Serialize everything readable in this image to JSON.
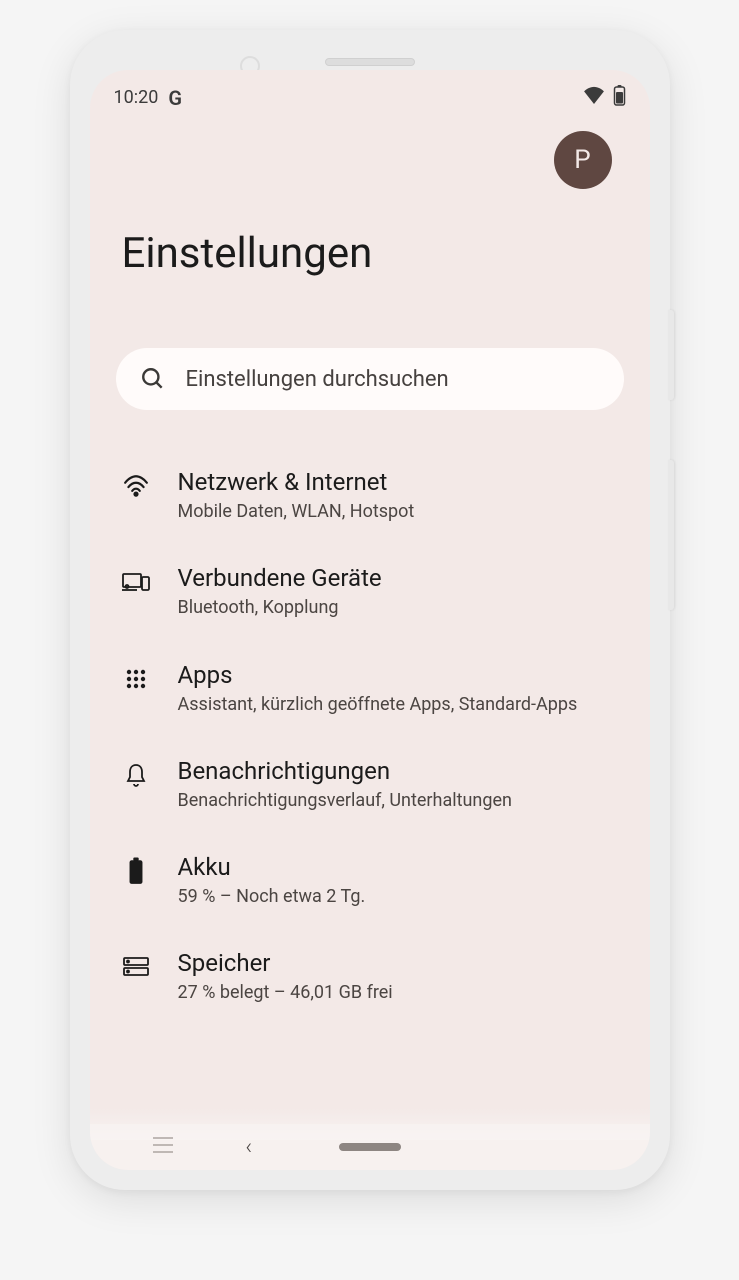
{
  "status": {
    "time": "10:20",
    "g": "G"
  },
  "header": {
    "avatar_initial": "P",
    "title": "Einstellungen"
  },
  "search": {
    "placeholder": "Einstellungen durchsuchen"
  },
  "items": [
    {
      "title": "Netzwerk & Internet",
      "subtitle": "Mobile Daten, WLAN, Hotspot"
    },
    {
      "title": "Verbundene Geräte",
      "subtitle": "Bluetooth, Kopplung"
    },
    {
      "title": "Apps",
      "subtitle": "Assistant, kürzlich geöffnete Apps, Standard‑Apps"
    },
    {
      "title": "Benachrichtigungen",
      "subtitle": "Benachrichtigungsverlauf, Unterhaltungen"
    },
    {
      "title": "Akku",
      "subtitle": "59 % – Noch etwa 2 Tg."
    },
    {
      "title": "Speicher",
      "subtitle": "27 % belegt – 46,01 GB frei"
    }
  ]
}
